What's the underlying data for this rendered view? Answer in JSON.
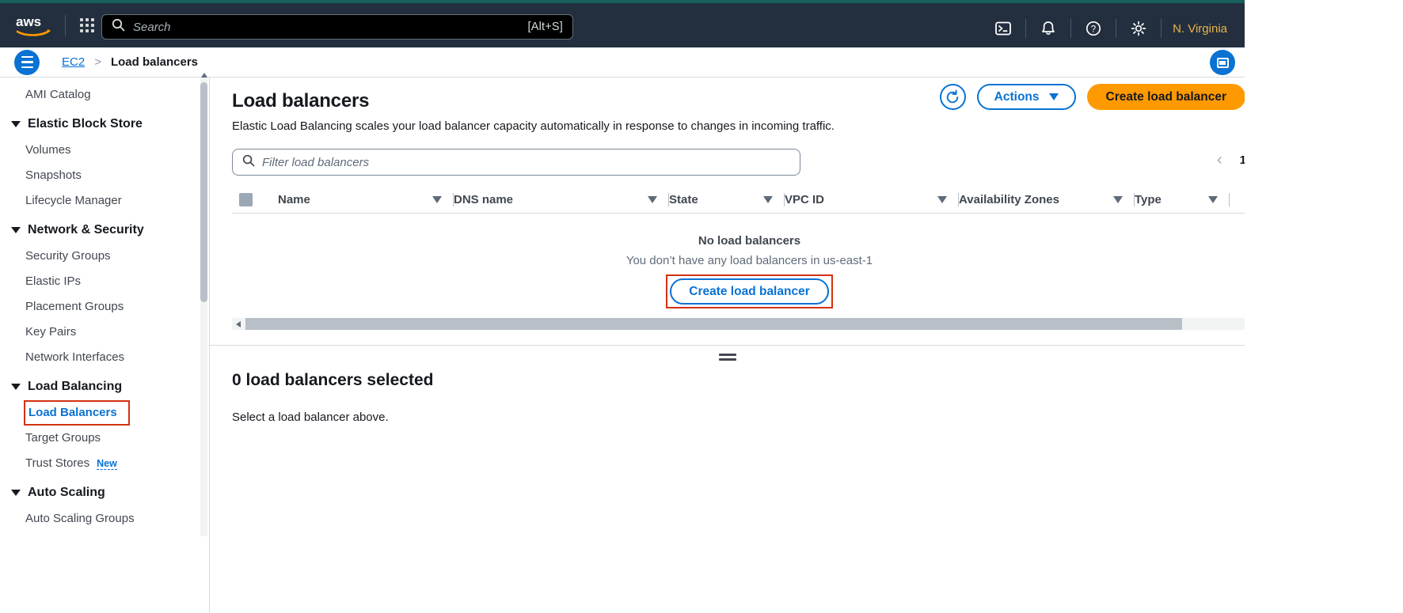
{
  "topnav": {
    "logo_alt": "aws",
    "apps_icon": "apps-grid-icon",
    "search": {
      "placeholder": "Search",
      "value": "",
      "shortcut": "[Alt+S]"
    },
    "icons": [
      {
        "name": "cloudshell-icon",
        "glyph": ">_"
      },
      {
        "name": "notifications-bell-icon",
        "glyph": "bell"
      },
      {
        "name": "help-icon",
        "glyph": "?"
      },
      {
        "name": "settings-gear-icon",
        "glyph": "gear"
      }
    ],
    "region": "N. Virginia"
  },
  "breadcrumb": {
    "menu_icon": "hamburger-menu-icon",
    "root": "EC2",
    "separator": ">",
    "current": "Load balancers",
    "panel_toggle_icon": "split-panel-toggle-icon"
  },
  "sidebar": {
    "items": [
      {
        "type": "link",
        "label": "AMI Catalog",
        "active": false
      },
      {
        "type": "group",
        "label": "Elastic Block Store"
      },
      {
        "type": "link",
        "label": "Volumes",
        "active": false
      },
      {
        "type": "link",
        "label": "Snapshots",
        "active": false
      },
      {
        "type": "link",
        "label": "Lifecycle Manager",
        "active": false
      },
      {
        "type": "group",
        "label": "Network & Security"
      },
      {
        "type": "link",
        "label": "Security Groups",
        "active": false
      },
      {
        "type": "link",
        "label": "Elastic IPs",
        "active": false
      },
      {
        "type": "link",
        "label": "Placement Groups",
        "active": false
      },
      {
        "type": "link",
        "label": "Key Pairs",
        "active": false
      },
      {
        "type": "link",
        "label": "Network Interfaces",
        "active": false
      },
      {
        "type": "group",
        "label": "Load Balancing"
      },
      {
        "type": "link",
        "label": "Load Balancers",
        "active": true
      },
      {
        "type": "link",
        "label": "Target Groups",
        "active": false
      },
      {
        "type": "link",
        "label": "Trust Stores",
        "active": false,
        "badge": "New"
      },
      {
        "type": "group",
        "label": "Auto Scaling"
      },
      {
        "type": "link",
        "label": "Auto Scaling Groups",
        "active": false
      }
    ]
  },
  "main": {
    "title": "Load balancers",
    "description": "Elastic Load Balancing scales your load balancer capacity automatically in response to changes in incoming traffic.",
    "refresh_icon": "refresh-icon",
    "actions_label": "Actions",
    "create_label": "Create load balancer",
    "filter": {
      "placeholder": "Filter load balancers",
      "value": "",
      "icon": "search-icon"
    },
    "pagination": {
      "prev": "‹",
      "page": "1"
    },
    "table": {
      "columns": [
        "Name",
        "DNS name",
        "State",
        "VPC ID",
        "Availability Zones",
        "Type"
      ],
      "rows": [],
      "empty_title": "No load balancers",
      "empty_subtitle": "You don’t have any load balancers in us-east-1",
      "empty_action": "Create load balancer"
    }
  },
  "detail_panel": {
    "title": "0 load balancers selected",
    "body": "Select a load balancer above."
  },
  "colors": {
    "nav_bg": "#232f3e",
    "nav_top_accent": "#17605e",
    "link_blue": "#0972d3",
    "accent_orange": "#ff9900",
    "highlight_red": "#d13212",
    "region_gold": "#e9b44c"
  }
}
